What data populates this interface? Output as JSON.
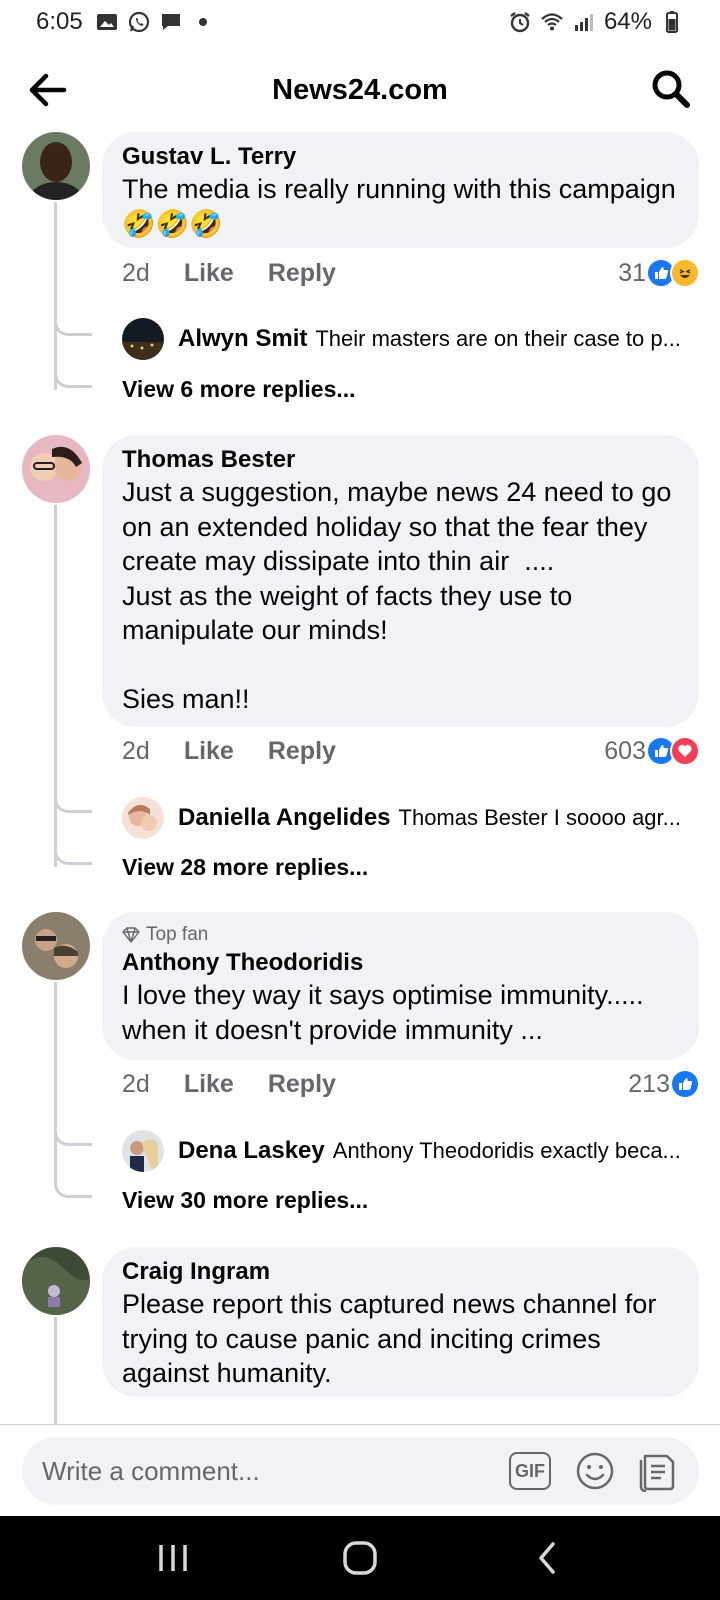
{
  "status_bar": {
    "time": "6:05",
    "battery": "64%"
  },
  "header": {
    "title": "News24.com"
  },
  "comments": [
    {
      "name": "Gustav L. Terry",
      "text": "The media is really running with this campaign 🤣🤣🤣",
      "time": "2d",
      "like_label": "Like",
      "reply_label": "Reply",
      "reaction_count": "31",
      "reactions": [
        "like",
        "haha"
      ],
      "reply_preview": {
        "name": "Alwyn Smit",
        "text": "Their masters are on their case to p..."
      },
      "view_more": "View 6 more replies..."
    },
    {
      "name": "Thomas Bester",
      "text": "Just a suggestion, maybe news 24 need to go on an extended holiday so that the fear they create may dissipate into thin air  ....\nJust as the weight of facts they use to manipulate our minds!\n\nSies man!!",
      "time": "2d",
      "like_label": "Like",
      "reply_label": "Reply",
      "reaction_count": "603",
      "reactions": [
        "like",
        "love"
      ],
      "reply_preview": {
        "name": "Daniella Angelides",
        "text": "Thomas Bester I soooo agr..."
      },
      "view_more": "View 28 more replies..."
    },
    {
      "badge": "Top fan",
      "name": "Anthony Theodoridis",
      "text": "I love they way it says optimise immunity..... when it doesn't provide immunity ...",
      "time": "2d",
      "like_label": "Like",
      "reply_label": "Reply",
      "reaction_count": "213",
      "reactions": [
        "like"
      ],
      "reply_preview": {
        "name": "Dena Laskey",
        "text": "Anthony Theodoridis exactly beca..."
      },
      "view_more": "View 30 more replies..."
    },
    {
      "name": "Craig Ingram",
      "text": "Please report this captured news channel for trying to cause panic and inciting crimes against humanity."
    }
  ],
  "composer": {
    "placeholder": "Write a comment...",
    "gif_label": "GIF"
  },
  "colors": {
    "like_blue": "#1877f2",
    "love_red": "#f33e58",
    "haha_yellow": "#f7b928",
    "bubble_bg": "#f0f2f5",
    "muted_text": "#65676b"
  },
  "icons": [
    "back-arrow-icon",
    "search-icon",
    "gif-icon",
    "emoji-icon",
    "sticker-icon",
    "recents-nav-icon",
    "home-nav-icon",
    "back-nav-icon",
    "diamond-icon"
  ]
}
